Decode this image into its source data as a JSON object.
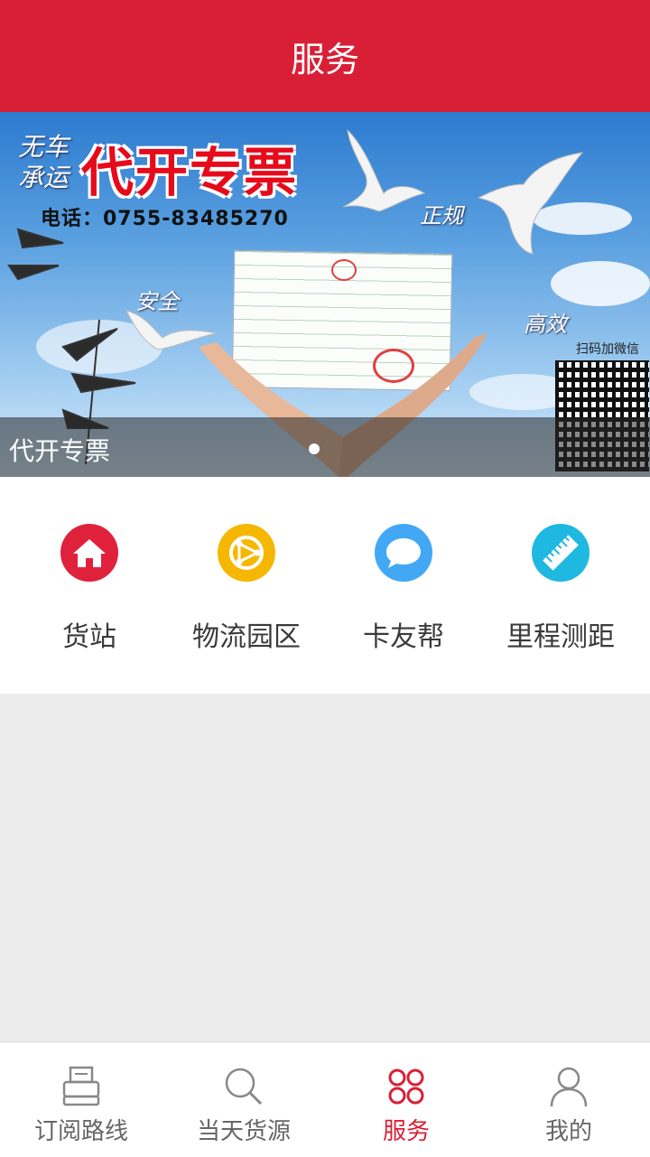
{
  "header": {
    "title": "服务"
  },
  "banner": {
    "title": "代开专票",
    "slogan_line1": "无车",
    "slogan_line2": "承运",
    "phone": "电话：0755-83485270",
    "word_safe": "安全",
    "word_fast": "正规",
    "word_efficient": "高效",
    "qr_caption": "扫码加微信",
    "caption": "代开专票",
    "page_indicator": {
      "current": 1,
      "total": 1
    }
  },
  "services": [
    {
      "label": "货站",
      "icon": "home-icon",
      "color": "#e0213c"
    },
    {
      "label": "物流园区",
      "icon": "logistics-park-icon",
      "color": "#f5b700"
    },
    {
      "label": "卡友帮",
      "icon": "chat-bubble-icon",
      "color": "#42a8f5"
    },
    {
      "label": "里程测距",
      "icon": "ruler-icon",
      "color": "#1eb8e0"
    }
  ],
  "tabbar": {
    "items": [
      {
        "label": "订阅路线",
        "icon": "printer-icon",
        "active": false
      },
      {
        "label": "当天货源",
        "icon": "search-icon",
        "active": false
      },
      {
        "label": "服务",
        "icon": "service-grid-icon",
        "active": true
      },
      {
        "label": "我的",
        "icon": "user-icon",
        "active": false
      }
    ]
  },
  "colors": {
    "accent": "#d91f36",
    "background": "#ececec"
  }
}
